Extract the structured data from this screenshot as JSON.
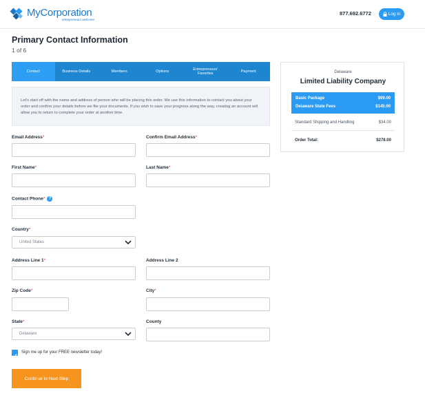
{
  "header": {
    "brand": "MyCorporation",
    "brand_mark": "®",
    "tagline": "entrepreneurs welcome",
    "phone": "877.692.6772",
    "login_label": "Log in"
  },
  "page": {
    "title": "Primary Contact Information",
    "step": "1 of 6"
  },
  "tabs": [
    {
      "label": "Contact",
      "active": true
    },
    {
      "label": "Business Details",
      "active": false
    },
    {
      "label": "Members",
      "active": false
    },
    {
      "label": "Options",
      "active": false
    },
    {
      "label": "Entrepreneurs' Favorites",
      "active": false
    },
    {
      "label": "Payment",
      "active": false
    }
  ],
  "intro": "Let's start off with the name and address of person who will be placing this order. We use this information to contact you about your order and confirm your details before we file your documents. If you wish to save your progress along the way, creating an account will allow you to return to complete your order at another time.",
  "form": {
    "email_label": "Email Address",
    "confirm_email_label": "Confirm Email Address",
    "first_name_label": "First Name",
    "last_name_label": "Last Name",
    "phone_label": "Contact Phone",
    "country_label": "Country",
    "country_value": "United States",
    "address1_label": "Address Line 1",
    "address2_label": "Address Line 2",
    "zip_label": "Zip Code",
    "city_label": "City",
    "state_label": "State",
    "state_value": "Delaware",
    "county_label": "County",
    "required_mark": "*",
    "help_mark": "?",
    "newsletter_label": "Sign me up for your FREE newsletter today!",
    "newsletter_checked": true,
    "submit_label": "Continue to Next Step"
  },
  "summary": {
    "state": "Delaware",
    "title": "Limited Liability Company",
    "highlight_rows": [
      {
        "label": "Basic Package",
        "amount": "$99.00"
      },
      {
        "label": "Delaware State Fees",
        "amount": "$145.00"
      }
    ],
    "shipping_label": "Standard Shipping and Handling",
    "shipping_amount": "$34.00",
    "total_label": "Order Total:",
    "total_amount": "$278.00"
  },
  "colors": {
    "brand_blue": "#1e78c8",
    "tab_blue": "#1e86d1",
    "accent_blue": "#2b9af3",
    "cta_orange": "#f7941d",
    "required_red": "#e0313a"
  }
}
